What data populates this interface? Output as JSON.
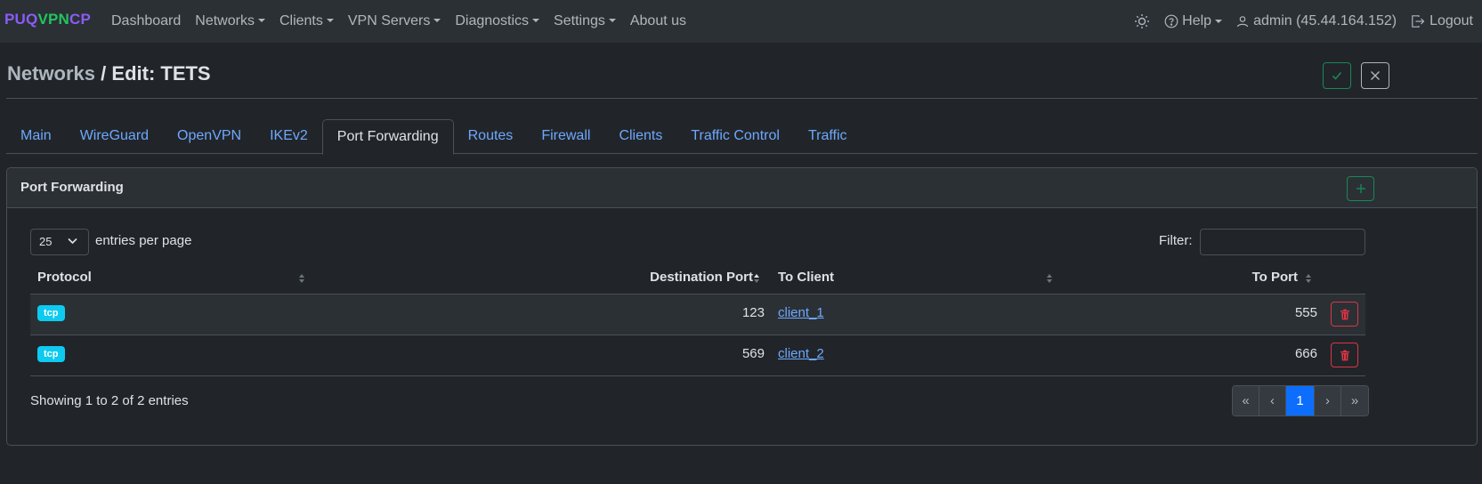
{
  "brand": {
    "part1": "PUQ",
    "part2": "VPN",
    "part3": "CP"
  },
  "colors": {
    "brand_purple": "#8b5cf6",
    "brand_green": "#22c55e",
    "link": "#6ea8fe",
    "badge": "#0dcaf0",
    "success": "#198754",
    "danger": "#dc3545",
    "primary": "#0d6efd"
  },
  "nav": {
    "items": [
      {
        "label": "Dashboard",
        "dropdown": false
      },
      {
        "label": "Networks",
        "dropdown": true
      },
      {
        "label": "Clients",
        "dropdown": true
      },
      {
        "label": "VPN Servers",
        "dropdown": true
      },
      {
        "label": "Diagnostics",
        "dropdown": true
      },
      {
        "label": "Settings",
        "dropdown": true
      },
      {
        "label": "About us",
        "dropdown": false
      }
    ],
    "theme_icon": "sun-icon",
    "help": "Help",
    "user": "admin (45.44.164.152)",
    "logout": "Logout"
  },
  "page": {
    "breadcrumb": "Networks",
    "separator": " / ",
    "title": "Edit: TETS"
  },
  "tabs": [
    {
      "label": "Main",
      "active": false
    },
    {
      "label": "WireGuard",
      "active": false
    },
    {
      "label": "OpenVPN",
      "active": false
    },
    {
      "label": "IKEv2",
      "active": false
    },
    {
      "label": "Port Forwarding",
      "active": true
    },
    {
      "label": "Routes",
      "active": false
    },
    {
      "label": "Firewall",
      "active": false
    },
    {
      "label": "Clients",
      "active": false
    },
    {
      "label": "Traffic Control",
      "active": false
    },
    {
      "label": "Traffic",
      "active": false
    }
  ],
  "card": {
    "title": "Port Forwarding",
    "per_page_value": "25",
    "per_page_label": "entries per page",
    "filter_label": "Filter:",
    "filter_value": "",
    "columns": {
      "protocol": "Protocol",
      "dest_port": "Destination Port",
      "to_client": "To Client",
      "to_port": "To Port"
    },
    "rows": [
      {
        "protocol": "tcp",
        "dest_port": "123",
        "to_client": "client_1",
        "to_port": "555"
      },
      {
        "protocol": "tcp",
        "dest_port": "569",
        "to_client": "client_2",
        "to_port": "666"
      }
    ],
    "showing": "Showing 1 to 2 of 2 entries",
    "pager": {
      "first": "«",
      "prev": "‹",
      "current": "1",
      "next": "›",
      "last": "»"
    }
  }
}
